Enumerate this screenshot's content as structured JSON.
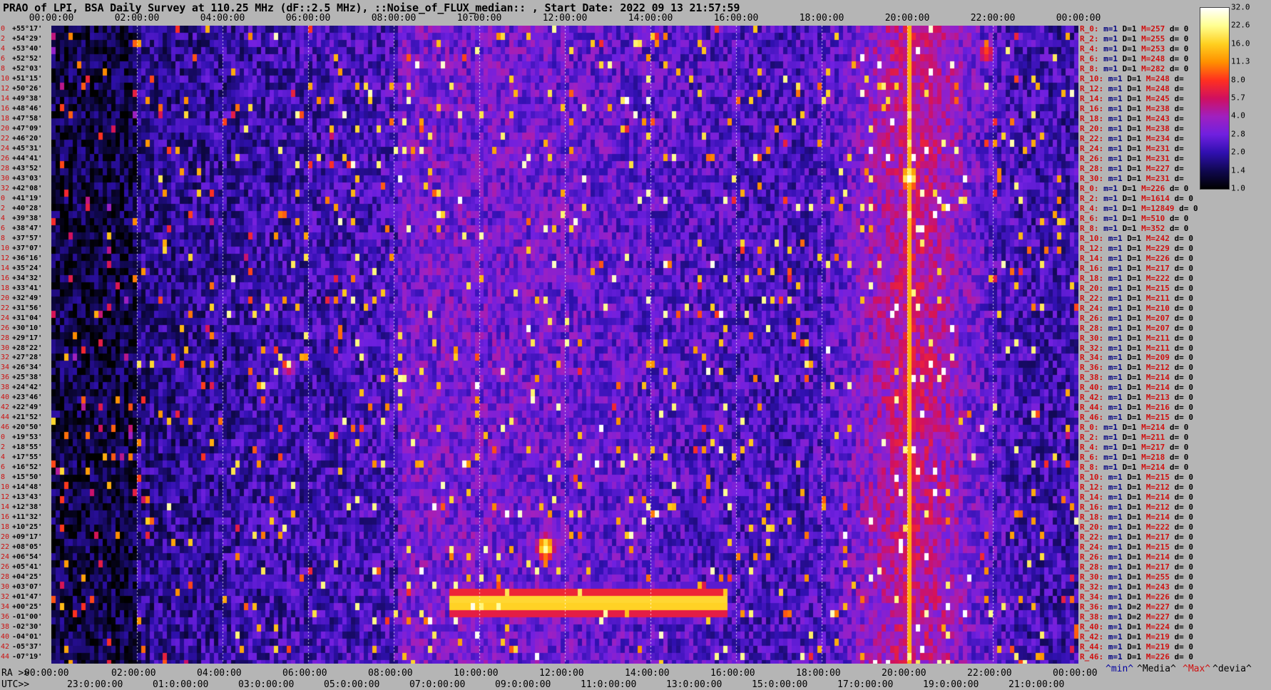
{
  "title": "PRAO of LPI, BSA Daily Survey at 110.25 MHz (dF::2.5 MHz), ::Noise_of_FLUX_median:: , Start Date: 2022 09 13 21:57:59",
  "top_ra_ticks": [
    "00:00:00",
    "02:00:00",
    "04:00:00",
    "06:00:00",
    "08:00:00",
    "10:00:00",
    "12:00:00",
    "14:00:00",
    "16:00:00",
    "18:00:00",
    "20:00:00",
    "22:00:00",
    "00:00:00"
  ],
  "bottom_ra_prefix": "RA >>",
  "bottom_ra_ticks": [
    "00:00:00",
    "02:00:00",
    "04:00:00",
    "06:00:00",
    "08:00:00",
    "10:00:00",
    "12:00:00",
    "14:00:00",
    "16:00:00",
    "18:00:00",
    "20:00:00",
    "22:00:00",
    "00:00:00"
  ],
  "bottom_utc_prefix": "UTC>>",
  "bottom_utc_ticks": [
    "23:0:00:00",
    "01:0:00:00",
    "03:0:00:00",
    "05:0:00:00",
    "07:0:00:00",
    "09:0:00:00",
    "11:0:00:00",
    "13:0:00:00",
    "15:0:00:00",
    "17:0:00:00",
    "19:0:00:00",
    "21:0:00:00"
  ],
  "legend": {
    "min": "^min^",
    "median": "^Media^",
    "max": "^Max^",
    "devia": "^devia^"
  },
  "colorbar": {
    "labels": [
      "32.0",
      "22.6",
      "16.0",
      "11.3",
      "8.0",
      "5.7",
      "4.0",
      "2.8",
      "2.0",
      "1.4",
      "1.0"
    ],
    "stops": [
      "#ffffff",
      "#ffff90",
      "#ffd020",
      "#ff9000",
      "#ff3020",
      "#d01060",
      "#a020c0",
      "#7020e0",
      "#3010b0",
      "#100850",
      "#000000"
    ]
  },
  "dec_rows": [
    {
      "i": "0",
      "d": "+55°17'"
    },
    {
      "i": "2",
      "d": "+54°29'"
    },
    {
      "i": "4",
      "d": "+53°40'"
    },
    {
      "i": "6",
      "d": "+52°52'"
    },
    {
      "i": "8",
      "d": "+52°03'"
    },
    {
      "i": "10",
      "d": "+51°15'"
    },
    {
      "i": "12",
      "d": "+50°26'"
    },
    {
      "i": "14",
      "d": "+49°38'"
    },
    {
      "i": "16",
      "d": "+48°46'"
    },
    {
      "i": "18",
      "d": "+47°58'"
    },
    {
      "i": "20",
      "d": "+47°09'"
    },
    {
      "i": "22",
      "d": "+46°20'"
    },
    {
      "i": "24",
      "d": "+45°31'"
    },
    {
      "i": "26",
      "d": "+44°41'"
    },
    {
      "i": "28",
      "d": "+43°52'"
    },
    {
      "i": "30",
      "d": "+43°03'"
    },
    {
      "i": "32",
      "d": "+42°08'"
    },
    {
      "i": "0",
      "d": "+41°19'"
    },
    {
      "i": "2",
      "d": "+40°28'"
    },
    {
      "i": "4",
      "d": "+39°38'"
    },
    {
      "i": "6",
      "d": "+38°47'"
    },
    {
      "i": "8",
      "d": "+37°57'"
    },
    {
      "i": "10",
      "d": "+37°07'"
    },
    {
      "i": "12",
      "d": "+36°16'"
    },
    {
      "i": "14",
      "d": "+35°24'"
    },
    {
      "i": "16",
      "d": "+34°32'"
    },
    {
      "i": "18",
      "d": "+33°41'"
    },
    {
      "i": "20",
      "d": "+32°49'"
    },
    {
      "i": "22",
      "d": "+31°56'"
    },
    {
      "i": "24",
      "d": "+31°04'"
    },
    {
      "i": "26",
      "d": "+30°10'"
    },
    {
      "i": "28",
      "d": "+29°17'"
    },
    {
      "i": "30",
      "d": "+28°22'"
    },
    {
      "i": "32",
      "d": "+27°28'"
    },
    {
      "i": "34",
      "d": "+26°34'"
    },
    {
      "i": "36",
      "d": "+25°38'"
    },
    {
      "i": "38",
      "d": "+24°42'"
    },
    {
      "i": "40",
      "d": "+23°46'"
    },
    {
      "i": "42",
      "d": "+22°49'"
    },
    {
      "i": "44",
      "d": "+21°52'"
    },
    {
      "i": "46",
      "d": "+20°50'"
    },
    {
      "i": "0",
      "d": "+19°53'"
    },
    {
      "i": "2",
      "d": "+18°55'"
    },
    {
      "i": "4",
      "d": "+17°55'"
    },
    {
      "i": "6",
      "d": "+16°52'"
    },
    {
      "i": "8",
      "d": "+15°50'"
    },
    {
      "i": "10",
      "d": "+14°48'"
    },
    {
      "i": "12",
      "d": "+13°43'"
    },
    {
      "i": "14",
      "d": "+12°38'"
    },
    {
      "i": "16",
      "d": "+11°32'"
    },
    {
      "i": "18",
      "d": "+10°25'"
    },
    {
      "i": "20",
      "d": "+09°17'"
    },
    {
      "i": "22",
      "d": "+08°05'"
    },
    {
      "i": "24",
      "d": "+06°54'"
    },
    {
      "i": "26",
      "d": "+05°41'"
    },
    {
      "i": "28",
      "d": "+04°25'"
    },
    {
      "i": "30",
      "d": "+03°07'"
    },
    {
      "i": "32",
      "d": "+01°47'"
    },
    {
      "i": "34",
      "d": "+00°25'"
    },
    {
      "i": "36",
      "d": "-01°00'"
    },
    {
      "i": "38",
      "d": "-02°30'"
    },
    {
      "i": "40",
      "d": "-04°01'"
    },
    {
      "i": "42",
      "d": "-05°37'"
    },
    {
      "i": "44",
      "d": "-07°19'"
    }
  ],
  "right_rows": [
    {
      "r": "R_0:",
      "m": "m=1",
      "D": "D=1",
      "M": "M=257",
      "dv": "d= 0"
    },
    {
      "r": "R_2:",
      "m": "m=1",
      "D": "D=1",
      "M": "M=255",
      "dv": "d= 0"
    },
    {
      "r": "R_4:",
      "m": "m=1",
      "D": "D=1",
      "M": "M=253",
      "dv": "d= 0"
    },
    {
      "r": "R_6:",
      "m": "m=1",
      "D": "D=1",
      "M": "M=248",
      "dv": "d= 0"
    },
    {
      "r": "R_8:",
      "m": "m=1",
      "D": "D=1",
      "M": "M=282",
      "dv": "d= 0"
    },
    {
      "r": "R_10:",
      "m": "m=1",
      "D": "D=1",
      "M": "M=248",
      "dv": "d="
    },
    {
      "r": "R_12:",
      "m": "m=1",
      "D": "D=1",
      "M": "M=248",
      "dv": "d="
    },
    {
      "r": "R_14:",
      "m": "m=1",
      "D": "D=1",
      "M": "M=245",
      "dv": "d="
    },
    {
      "r": "R_16:",
      "m": "m=1",
      "D": "D=1",
      "M": "M=238",
      "dv": "d="
    },
    {
      "r": "R_18:",
      "m": "m=1",
      "D": "D=1",
      "M": "M=243",
      "dv": "d="
    },
    {
      "r": "R_20:",
      "m": "m=1",
      "D": "D=1",
      "M": "M=238",
      "dv": "d="
    },
    {
      "r": "R_22:",
      "m": "m=1",
      "D": "D=1",
      "M": "M=234",
      "dv": "d="
    },
    {
      "r": "R_24:",
      "m": "m=1",
      "D": "D=1",
      "M": "M=231",
      "dv": "d="
    },
    {
      "r": "R_26:",
      "m": "m=1",
      "D": "D=1",
      "M": "M=231",
      "dv": "d="
    },
    {
      "r": "R_28:",
      "m": "m=1",
      "D": "D=1",
      "M": "M=227",
      "dv": "d="
    },
    {
      "r": "R_30:",
      "m": "m=1",
      "D": "D=1",
      "M": "M=231",
      "dv": "d="
    },
    {
      "r": "R_0:",
      "m": "m=1",
      "D": "D=1",
      "M": "M=226",
      "dv": "d= 0"
    },
    {
      "r": "R_2:",
      "m": "m=1",
      "D": "D=1",
      "M": "M=1614",
      "dv": "d= 0"
    },
    {
      "r": "R_4:",
      "m": "m=1",
      "D": "D=1",
      "M": "M=12849",
      "dv": "d= 0"
    },
    {
      "r": "R_6:",
      "m": "m=1",
      "D": "D=1",
      "M": "M=510",
      "dv": "d= 0"
    },
    {
      "r": "R_8:",
      "m": "m=1",
      "D": "D=1",
      "M": "M=352",
      "dv": "d= 0"
    },
    {
      "r": "R_10:",
      "m": "m=1",
      "D": "D=1",
      "M": "M=242",
      "dv": "d= 0"
    },
    {
      "r": "R_12:",
      "m": "m=1",
      "D": "D=1",
      "M": "M=229",
      "dv": "d= 0"
    },
    {
      "r": "R_14:",
      "m": "m=1",
      "D": "D=1",
      "M": "M=226",
      "dv": "d= 0"
    },
    {
      "r": "R_16:",
      "m": "m=1",
      "D": "D=1",
      "M": "M=217",
      "dv": "d= 0"
    },
    {
      "r": "R_18:",
      "m": "m=1",
      "D": "D=1",
      "M": "M=222",
      "dv": "d= 0"
    },
    {
      "r": "R_20:",
      "m": "m=1",
      "D": "D=1",
      "M": "M=215",
      "dv": "d= 0"
    },
    {
      "r": "R_22:",
      "m": "m=1",
      "D": "D=1",
      "M": "M=211",
      "dv": "d= 0"
    },
    {
      "r": "R_24:",
      "m": "m=1",
      "D": "D=1",
      "M": "M=210",
      "dv": "d= 0"
    },
    {
      "r": "R_26:",
      "m": "m=1",
      "D": "D=1",
      "M": "M=207",
      "dv": "d= 0"
    },
    {
      "r": "R_28:",
      "m": "m=1",
      "D": "D=1",
      "M": "M=207",
      "dv": "d= 0"
    },
    {
      "r": "R_30:",
      "m": "m=1",
      "D": "D=1",
      "M": "M=211",
      "dv": "d= 0"
    },
    {
      "r": "R_32:",
      "m": "m=1",
      "D": "D=1",
      "M": "M=211",
      "dv": "d= 0"
    },
    {
      "r": "R_34:",
      "m": "m=1",
      "D": "D=1",
      "M": "M=209",
      "dv": "d= 0"
    },
    {
      "r": "R_36:",
      "m": "m=1",
      "D": "D=1",
      "M": "M=212",
      "dv": "d= 0"
    },
    {
      "r": "R_38:",
      "m": "m=1",
      "D": "D=1",
      "M": "M=214",
      "dv": "d= 0"
    },
    {
      "r": "R_40:",
      "m": "m=1",
      "D": "D=1",
      "M": "M=214",
      "dv": "d= 0"
    },
    {
      "r": "R_42:",
      "m": "m=1",
      "D": "D=1",
      "M": "M=213",
      "dv": "d= 0"
    },
    {
      "r": "R_44:",
      "m": "m=1",
      "D": "D=1",
      "M": "M=216",
      "dv": "d= 0"
    },
    {
      "r": "R_46:",
      "m": "m=1",
      "D": "D=1",
      "M": "M=215",
      "dv": "d= 0"
    },
    {
      "r": "R_0:",
      "m": "m=1",
      "D": "D=1",
      "M": "M=214",
      "dv": "d= 0"
    },
    {
      "r": "R_2:",
      "m": "m=1",
      "D": "D=1",
      "M": "M=211",
      "dv": "d= 0"
    },
    {
      "r": "R_4:",
      "m": "m=1",
      "D": "D=1",
      "M": "M=217",
      "dv": "d= 0"
    },
    {
      "r": "R_6:",
      "m": "m=1",
      "D": "D=1",
      "M": "M=218",
      "dv": "d= 0"
    },
    {
      "r": "R_8:",
      "m": "m=1",
      "D": "D=1",
      "M": "M=214",
      "dv": "d= 0"
    },
    {
      "r": "R_10:",
      "m": "m=1",
      "D": "D=1",
      "M": "M=215",
      "dv": "d= 0"
    },
    {
      "r": "R_12:",
      "m": "m=1",
      "D": "D=1",
      "M": "M=212",
      "dv": "d= 0"
    },
    {
      "r": "R_14:",
      "m": "m=1",
      "D": "D=1",
      "M": "M=214",
      "dv": "d= 0"
    },
    {
      "r": "R_16:",
      "m": "m=1",
      "D": "D=1",
      "M": "M=212",
      "dv": "d= 0"
    },
    {
      "r": "R_18:",
      "m": "m=1",
      "D": "D=1",
      "M": "M=214",
      "dv": "d= 0"
    },
    {
      "r": "R_20:",
      "m": "m=1",
      "D": "D=1",
      "M": "M=222",
      "dv": "d= 0"
    },
    {
      "r": "R_22:",
      "m": "m=1",
      "D": "D=1",
      "M": "M=217",
      "dv": "d= 0"
    },
    {
      "r": "R_24:",
      "m": "m=1",
      "D": "D=1",
      "M": "M=215",
      "dv": "d= 0"
    },
    {
      "r": "R_26:",
      "m": "m=1",
      "D": "D=1",
      "M": "M=214",
      "dv": "d= 0"
    },
    {
      "r": "R_28:",
      "m": "m=1",
      "D": "D=1",
      "M": "M=217",
      "dv": "d= 0"
    },
    {
      "r": "R_30:",
      "m": "m=1",
      "D": "D=1",
      "M": "M=255",
      "dv": "d= 0"
    },
    {
      "r": "R_32:",
      "m": "m=1",
      "D": "D=1",
      "M": "M=243",
      "dv": "d= 0"
    },
    {
      "r": "R_34:",
      "m": "m=1",
      "D": "D=1",
      "M": "M=226",
      "dv": "d= 0"
    },
    {
      "r": "R_36:",
      "m": "m=1",
      "D": "D=2",
      "M": "M=227",
      "dv": "d= 0"
    },
    {
      "r": "R_38:",
      "m": "m=1",
      "D": "D=2",
      "M": "M=227",
      "dv": "d= 0"
    },
    {
      "r": "R_40:",
      "m": "m=1",
      "D": "D=1",
      "M": "M=224",
      "dv": "d= 0"
    },
    {
      "r": "R_42:",
      "m": "m=1",
      "D": "D=1",
      "M": "M=219",
      "dv": "d= 0"
    },
    {
      "r": "R_44:",
      "m": "m=1",
      "D": "D=1",
      "M": "M=219",
      "dv": "d= 0"
    },
    {
      "r": "R_46:",
      "m": "m=1",
      "D": "D=1",
      "M": "M=226",
      "dv": "d= 0"
    }
  ],
  "chart_data": {
    "type": "heatmap",
    "x_axis": "RA (h)",
    "xlim": [
      0,
      24
    ],
    "dec_range": [
      "+55°17'",
      "-07°19'"
    ],
    "grid": true,
    "colormap_range": [
      1.0,
      32.0
    ],
    "vertical_guides_ra_h": [
      2,
      4,
      6,
      8,
      10,
      12,
      14,
      16,
      18,
      20,
      22
    ],
    "bright_sources": [
      {
        "ra_h": 20.0,
        "dec_deg": 40.7,
        "intensity": 32
      },
      {
        "ra_h": 11.5,
        "dec_deg": 4.4,
        "intensity": 30
      },
      {
        "ra_h": 21.8,
        "dec_deg": 53.0,
        "intensity": 20
      },
      {
        "ra_h": 5.5,
        "dec_deg": 22.0,
        "intensity": 16
      }
    ],
    "bands": [
      {
        "ra_start_h": 9.3,
        "ra_end_h": 15.7,
        "dec_deg": -1.0,
        "intensity": 20
      },
      {
        "ra_start_h": 20.0,
        "ra_end_h": 20.0,
        "dec_all": true,
        "intensity": 24
      }
    ]
  }
}
